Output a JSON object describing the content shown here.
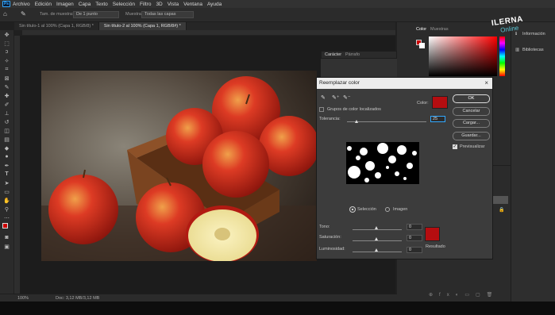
{
  "app": {
    "logo": "Ps"
  },
  "menu": [
    "Archivo",
    "Edición",
    "Imagen",
    "Capa",
    "Texto",
    "Selección",
    "Filtro",
    "3D",
    "Vista",
    "Ventana",
    "Ayuda"
  ],
  "options": {
    "sample_label": "Tam. de muestra:",
    "sample_value": "De 1 punto",
    "sample_source_label": "Muestra:",
    "sample_source_value": "Todas las capas"
  },
  "tabs": [
    "Sin título-1 al 100% (Capa 1, RGB/8) *",
    "Sin título-2 al 100% (Capa 1, RGB/8#) *"
  ],
  "status": {
    "zoom": "100%",
    "doc": "Doc: 3,12 MB/3,12 MB"
  },
  "panels": {
    "color_tab": "Color",
    "swatches_tab": "Muestras",
    "char_tab": "Carácter",
    "para_tab": "Párrafo",
    "side_items": [
      "Información",
      "Bibliotecas"
    ],
    "accent_red": "#cc0000"
  },
  "watermark": {
    "line1": "ILERNA",
    "line2": "Online"
  },
  "dialog": {
    "title": "Reemplazar color",
    "localized_label": "Grupos de color localizados",
    "color_label": "Color:",
    "tolerance_label": "Tolerancia:",
    "tolerance_value": "25",
    "selection_label": "Selección",
    "image_label": "Imagen",
    "hue_label": "Tono:",
    "hue_value": "0",
    "saturation_label": "Saturación:",
    "saturation_value": "0",
    "lightness_label": "Luminosidad:",
    "lightness_value": "0",
    "result_label": "Resultado",
    "ok": "OK",
    "cancel": "Cancelar",
    "load": "Cargar...",
    "save": "Guardar...",
    "preview_label": "Previsualizar",
    "sample_color": "#b50d10",
    "result_color": "#b50d10"
  }
}
